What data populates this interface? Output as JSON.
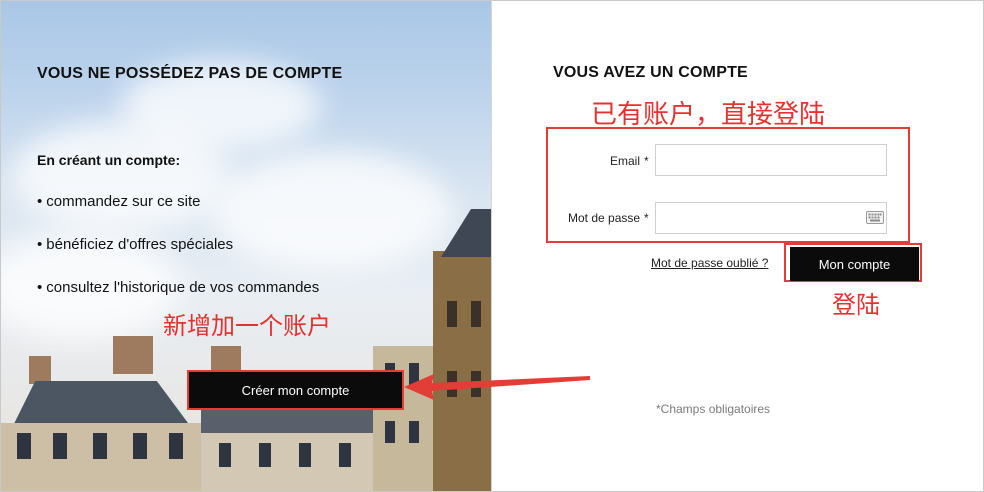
{
  "left": {
    "title": "VOUS NE POSSÉDEZ PAS DE COMPTE",
    "subtitle": "En créant un compte:",
    "benefits": [
      "commandez sur ce site",
      "bénéficiez d'offres spéciales",
      "consultez l'historique de vos commandes"
    ],
    "bullet": "•",
    "create_button": "Créer mon compte"
  },
  "right": {
    "title": "VOUS AVEZ UN COMPTE",
    "email_label": "Email",
    "password_label": "Mot de passe",
    "required_mark": "*",
    "forgot_link": "Mot de passe oublié ?",
    "login_button": "Mon compte",
    "required_note": "*Champs obligatoires"
  },
  "annotations": {
    "new_account": "新增加一个账户",
    "existing_account": "已有账户，直接登陆",
    "login": "登陆"
  },
  "colors": {
    "annotation_red": "#e23d36",
    "button_black": "#0b0b0b"
  },
  "icons": {
    "keyboard": "keyboard-icon",
    "arrow": "arrow-icon"
  }
}
